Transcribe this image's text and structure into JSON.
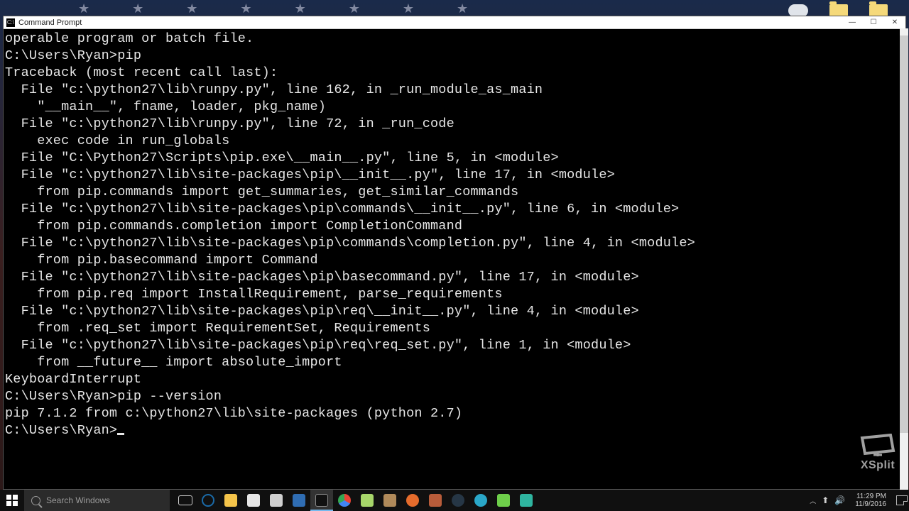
{
  "window": {
    "title": "Command Prompt"
  },
  "terminal": {
    "lines": [
      "operable program or batch file.",
      "",
      "C:\\Users\\Ryan>pip",
      "Traceback (most recent call last):",
      "  File \"c:\\python27\\lib\\runpy.py\", line 162, in _run_module_as_main",
      "    \"__main__\", fname, loader, pkg_name)",
      "  File \"c:\\python27\\lib\\runpy.py\", line 72, in _run_code",
      "    exec code in run_globals",
      "  File \"C:\\Python27\\Scripts\\pip.exe\\__main__.py\", line 5, in <module>",
      "  File \"c:\\python27\\lib\\site-packages\\pip\\__init__.py\", line 17, in <module>",
      "    from pip.commands import get_summaries, get_similar_commands",
      "  File \"c:\\python27\\lib\\site-packages\\pip\\commands\\__init__.py\", line 6, in <module>",
      "    from pip.commands.completion import CompletionCommand",
      "  File \"c:\\python27\\lib\\site-packages\\pip\\commands\\completion.py\", line 4, in <module>",
      "    from pip.basecommand import Command",
      "  File \"c:\\python27\\lib\\site-packages\\pip\\basecommand.py\", line 17, in <module>",
      "    from pip.req import InstallRequirement, parse_requirements",
      "  File \"c:\\python27\\lib\\site-packages\\pip\\req\\__init__.py\", line 4, in <module>",
      "    from .req_set import RequirementSet, Requirements",
      "  File \"c:\\python27\\lib\\site-packages\\pip\\req\\req_set.py\", line 1, in <module>",
      "    from __future__ import absolute_import",
      "KeyboardInterrupt",
      "",
      "C:\\Users\\Ryan>pip --version",
      "pip 7.1.2 from c:\\python27\\lib\\site-packages (python 2.7)",
      "",
      "C:\\Users\\Ryan>"
    ]
  },
  "watermark": {
    "text": "XSplit"
  },
  "taskbar": {
    "search_placeholder": "Search Windows",
    "apps": [
      {
        "name": "task-view",
        "color": "#d0d0d0"
      },
      {
        "name": "edge",
        "color": "#3a9bdc"
      },
      {
        "name": "file-explorer",
        "color": "#f5c44a"
      },
      {
        "name": "store",
        "color": "#e6e6e6"
      },
      {
        "name": "calculator",
        "color": "#d0d0d0"
      },
      {
        "name": "powershell",
        "color": "#2f6db3"
      },
      {
        "name": "command-prompt",
        "color": "#111111",
        "active": true
      },
      {
        "name": "chrome",
        "color": "#e8e8e8"
      },
      {
        "name": "notepad-plus",
        "color": "#a7d66a"
      },
      {
        "name": "gimp",
        "color": "#b08a5a"
      },
      {
        "name": "firefox",
        "color": "#e66c2c"
      },
      {
        "name": "git-bash",
        "color": "#b85c3a"
      },
      {
        "name": "steam",
        "color": "#263645"
      },
      {
        "name": "app-globe",
        "color": "#2aa7c8"
      },
      {
        "name": "app-green",
        "color": "#6ecf4a"
      },
      {
        "name": "app-teal",
        "color": "#2fb5a0"
      }
    ],
    "clock": {
      "time": "11:29 PM",
      "date": "11/9/2016"
    }
  }
}
